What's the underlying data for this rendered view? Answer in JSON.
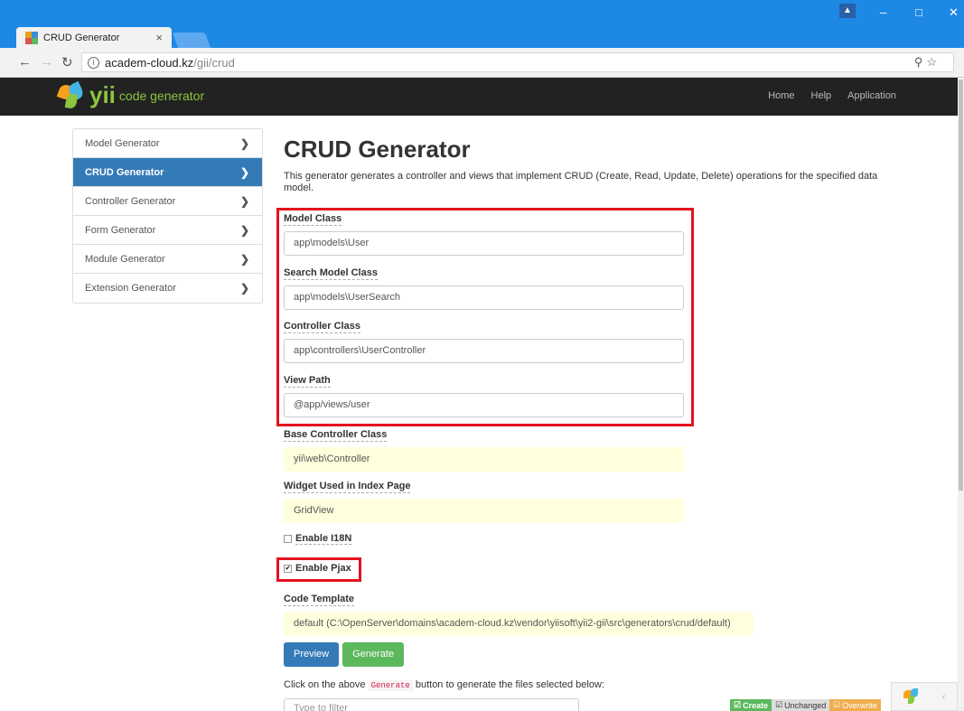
{
  "browser": {
    "tab_title": "CRUD Generator",
    "tab_close": "×",
    "url_host": "academ-cloud.kz",
    "url_path": "/gii/crud",
    "window_controls": [
      "–",
      "□",
      "✕"
    ]
  },
  "navbar": {
    "logo_yii": "yii",
    "logo_text": "code generator",
    "links": [
      "Home",
      "Help",
      "Application"
    ]
  },
  "sidebar": {
    "items": [
      {
        "label": "Model Generator",
        "active": false
      },
      {
        "label": "CRUD Generator",
        "active": true
      },
      {
        "label": "Controller Generator",
        "active": false
      },
      {
        "label": "Form Generator",
        "active": false
      },
      {
        "label": "Module Generator",
        "active": false
      },
      {
        "label": "Extension Generator",
        "active": false
      }
    ]
  },
  "main": {
    "title": "CRUD Generator",
    "description": "This generator generates a controller and views that implement CRUD (Create, Read, Update, Delete) operations for the specified data model.",
    "fields": {
      "model_class": {
        "label": "Model Class",
        "value": "app\\models\\User"
      },
      "search_model_class": {
        "label": "Search Model Class",
        "value": "app\\models\\UserSearch"
      },
      "controller_class": {
        "label": "Controller Class",
        "value": "app\\controllers\\UserController"
      },
      "view_path": {
        "label": "View Path",
        "value": "@app/views/user"
      },
      "base_controller_class": {
        "label": "Base Controller Class",
        "value": "yii\\web\\Controller"
      },
      "widget": {
        "label": "Widget Used in Index Page",
        "value": "GridView"
      },
      "code_template": {
        "label": "Code Template",
        "value": "default (C:\\OpenServer\\domains\\academ-cloud.kz\\vendor\\yiisoft\\yii2-gii\\src\\generators\\crud/default)"
      }
    },
    "enable_i18n": {
      "label": "Enable I18N",
      "checked": false
    },
    "enable_pjax": {
      "label": "Enable Pjax",
      "checked": true
    },
    "buttons": {
      "preview": "Preview",
      "generate": "Generate"
    },
    "hint_before": "Click on the above",
    "hint_code": "Generate",
    "hint_after": "button to generate the files selected below:",
    "filter_placeholder": "Type to filter"
  },
  "legend": {
    "create": "Create",
    "unchanged": "Unchanged",
    "overwrite": "Overwrite"
  },
  "colors": {
    "accent_red": "#e4121f",
    "primary_blue": "#337ab7",
    "success_green": "#5cb85c",
    "chrome_blue": "#1e88e5"
  }
}
